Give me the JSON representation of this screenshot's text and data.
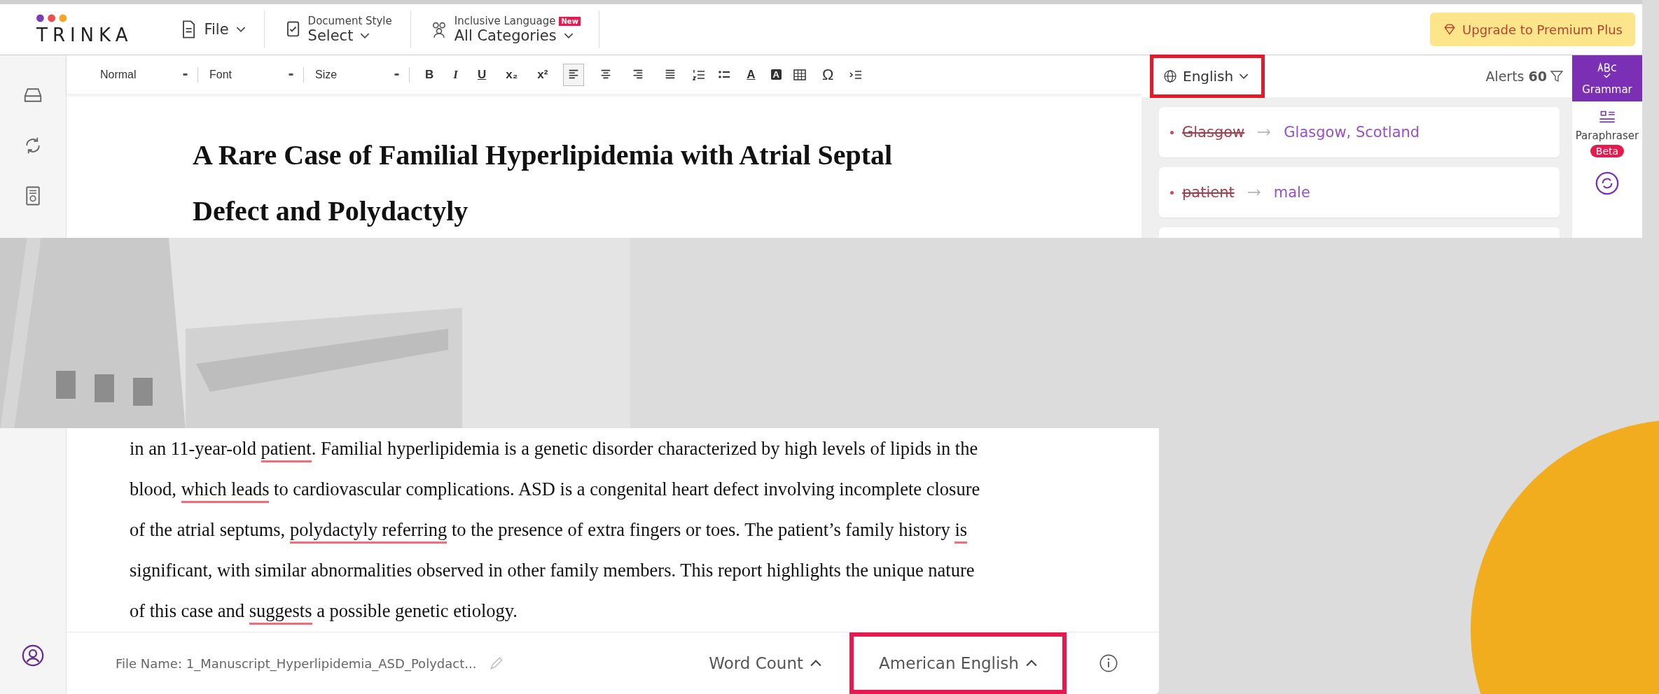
{
  "header": {
    "logo": "TRINKA",
    "menus": [
      {
        "kind": "file",
        "label": "File"
      },
      {
        "kind": "style",
        "caption": "Document Style",
        "label": "Select"
      },
      {
        "kind": "inclusive",
        "caption": "Inclusive Language",
        "badge": "New",
        "label": "All Categories"
      }
    ],
    "upgrade": "Upgrade to Premium Plus"
  },
  "toolbar": [
    {
      "kind": "select",
      "label": "Normal"
    },
    {
      "kind": "select",
      "label": "Font"
    },
    {
      "kind": "select",
      "label": "Size"
    },
    {
      "kind": "bold",
      "label": "B"
    },
    {
      "kind": "italic",
      "label": "I"
    },
    {
      "kind": "underline",
      "label": "U"
    },
    {
      "kind": "sub",
      "label": "x₂"
    },
    {
      "kind": "sup",
      "label": "x²"
    },
    {
      "kind": "align-left",
      "selected": true
    },
    {
      "kind": "align-center",
      "selected": false
    },
    {
      "kind": "align-right",
      "selected": false
    },
    {
      "kind": "align-justify",
      "selected": false
    },
    {
      "kind": "numbered-list"
    },
    {
      "kind": "bullet-list"
    },
    {
      "kind": "text-color",
      "label": "A"
    },
    {
      "kind": "highlight",
      "label": "A"
    },
    {
      "kind": "table"
    },
    {
      "kind": "symbol",
      "label": "Ω"
    },
    {
      "kind": "indent"
    }
  ],
  "document": {
    "title": [
      "A Rare Case of Familial Hyperlipidemia with Atrial Septal",
      "Defect and Polydactyly"
    ],
    "lines": [
      [
        {
          "text": "in an 11-year-old ",
          "flagged": false
        },
        {
          "text": "patient",
          "flagged": true
        },
        {
          "text": ". Familial hyperlipidemia is a genetic disorder characterized by high levels of lipids in the",
          "flagged": false
        }
      ],
      [
        {
          "text": "blood, ",
          "flagged": false
        },
        {
          "text": "which leads",
          "flagged": true
        },
        {
          "text": " to cardiovascular complications. ASD is a congenital heart defect involving incomplete closure",
          "flagged": false
        }
      ],
      [
        {
          "text": "of the atrial septums, ",
          "flagged": false
        },
        {
          "text": "polydactyly referring",
          "flagged": true
        },
        {
          "text": " to the presence of extra fingers or toes. The patient’s family history ",
          "flagged": false
        },
        {
          "text": "is",
          "flagged": true
        }
      ],
      [
        {
          "text": "significant, with similar abnormalities observed in other family members. This report highlights the unique nature",
          "flagged": false
        }
      ],
      [
        {
          "text": "of this case and ",
          "flagged": false
        },
        {
          "text": "suggests",
          "flagged": true
        },
        {
          "text": " a possible genetic etiology.",
          "flagged": false
        }
      ]
    ]
  },
  "alerts_panel": {
    "language": "English",
    "alerts_label": "Alerts",
    "alerts_count": "60",
    "cards": [
      {
        "original": "Glasgow",
        "suggestion": "Glasgow, Scotland"
      },
      {
        "original": "patient",
        "suggestion": "male"
      }
    ]
  },
  "tools": [
    {
      "kind": "grammar",
      "label": "Grammar",
      "selected": true
    },
    {
      "kind": "paraphraser",
      "label": "Paraphraser",
      "badge": "Beta",
      "selected": false
    },
    {
      "kind": "other",
      "selected": false
    }
  ],
  "footer": {
    "file_label": "File Name:",
    "file_name": "1_Manuscript_Hyperlipidemia_ASD_Polydact...",
    "word_count": "Word Count",
    "language": "American English"
  }
}
